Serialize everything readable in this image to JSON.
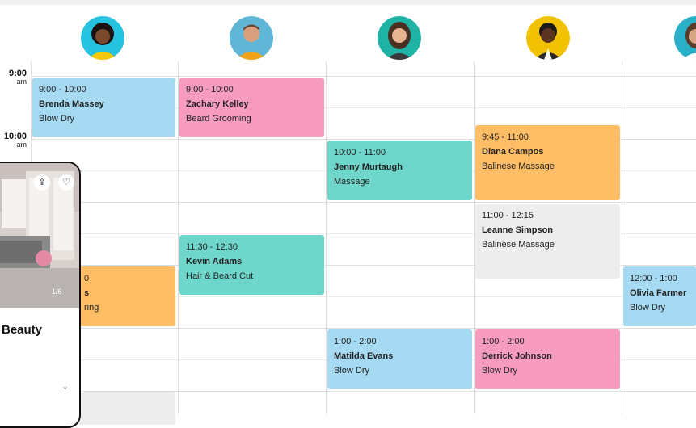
{
  "staff": [
    {
      "name": "stylist-1",
      "bg": "#26c3e0"
    },
    {
      "name": "stylist-2",
      "bg": "#5fb6d6"
    },
    {
      "name": "stylist-3",
      "bg": "#1fb3a6"
    },
    {
      "name": "stylist-4",
      "bg": "#f2c200"
    },
    {
      "name": "stylist-5",
      "bg": "#2ab0c8"
    }
  ],
  "times": [
    {
      "hour": "9:00",
      "ampm": "am"
    },
    {
      "hour": "10:00",
      "ampm": "am"
    }
  ],
  "appointments": [
    {
      "time": "9:00 - 10:00",
      "client": "Brenda Massey",
      "service": "Blow Dry",
      "color": "blue"
    },
    {
      "time": "9:00 - 10:00",
      "client": "Zachary Kelley",
      "service": "Beard Grooming",
      "color": "pink"
    },
    {
      "time": "10:00 - 11:00",
      "client": "Jenny Murtaugh",
      "service": "Massage",
      "color": "teal"
    },
    {
      "time": "9:45 - 11:00",
      "client": "Diana Campos",
      "service": "Balinese Massage",
      "color": "orange"
    },
    {
      "time": "11:00 - 12:15",
      "client": "Leanne Simpson",
      "service": "Balinese Massage",
      "color": "grey"
    },
    {
      "time": "11:30 - 12:30",
      "client": "Kevin Adams",
      "service": "Hair & Beard Cut",
      "color": "teal"
    },
    {
      "time": "12:00 - 1:00",
      "client": "Olivia Farmer",
      "service": "Blow Dry",
      "color": "blue"
    },
    {
      "time": "1:00 - 2:00",
      "client": "Matilda Evans",
      "service": "Blow Dry",
      "color": "blue"
    },
    {
      "time": "1:00 - 2:00",
      "client": "Derrick Johnson",
      "service": "Blow Dry",
      "color": "pink"
    },
    {
      "time": "0",
      "client": "s",
      "service": "ring",
      "color": "orange"
    }
  ],
  "phone": {
    "title": "Beauty",
    "counter": "1/6",
    "share_icon": "share-icon",
    "heart_icon": "heart-icon",
    "chevron_icon": "chevron-down-icon"
  },
  "colors": {
    "blue": "#a6daf3",
    "pink": "#f79cbe",
    "teal": "#6fd6cb",
    "orange": "#ffbd66",
    "grey": "#ededed"
  }
}
